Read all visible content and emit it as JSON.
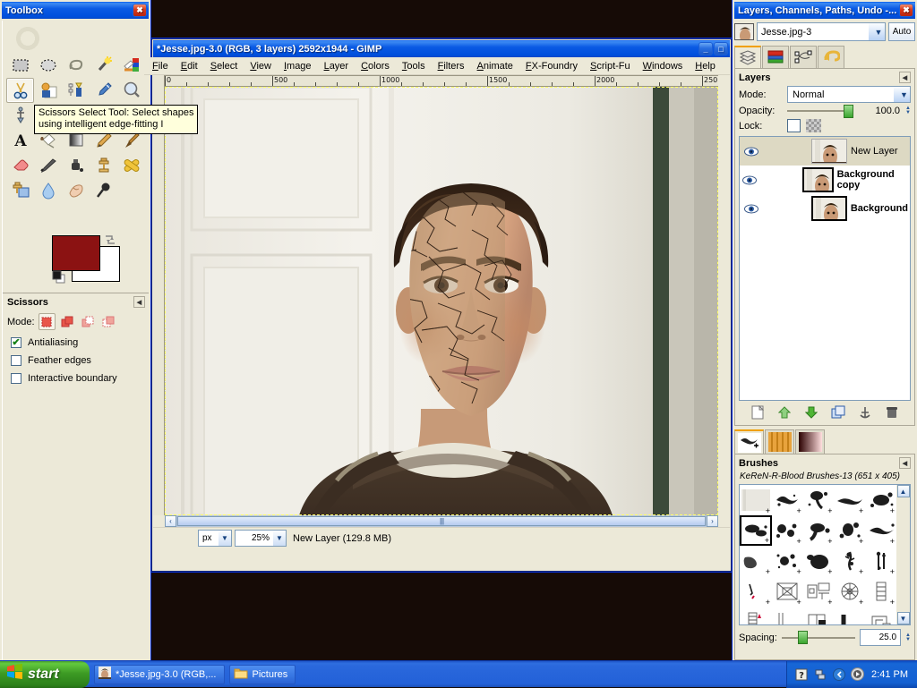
{
  "desktop": {
    "bg_color": "#160b06"
  },
  "toolbox": {
    "title": "Toolbox",
    "close_label": "✖",
    "tools": [
      {
        "name": "rect-select-tool",
        "label": "Rectangle Select"
      },
      {
        "name": "ellipse-select-tool",
        "label": "Ellipse Select"
      },
      {
        "name": "free-select-tool",
        "label": "Free Select"
      },
      {
        "name": "fuzzy-select-tool",
        "label": "Fuzzy Select"
      },
      {
        "name": "select-by-color-tool",
        "label": "Select By Color"
      },
      {
        "name": "scissors-select-tool",
        "label": "Scissors Select"
      },
      {
        "name": "foreground-select-tool",
        "label": "Foreground Select"
      },
      {
        "name": "paths-tool",
        "label": "Paths"
      },
      {
        "name": "color-picker-tool",
        "label": "Color Picker"
      },
      {
        "name": "zoom-tool",
        "label": "Zoom"
      },
      {
        "name": "measure-tool",
        "label": "Measure"
      },
      {
        "name": "move-tool",
        "label": "Move"
      },
      {
        "name": "align-tool",
        "label": "Alignment"
      },
      {
        "name": "crop-tool",
        "label": "Crop"
      },
      {
        "name": "rotate-tool",
        "label": "Rotate"
      },
      {
        "name": "scale-tool",
        "label": "Scale"
      },
      {
        "name": "shear-tool",
        "label": "Shear"
      },
      {
        "name": "perspective-tool",
        "label": "Perspective"
      },
      {
        "name": "flip-tool",
        "label": "Flip"
      },
      {
        "name": "text-tool",
        "label": "Text"
      },
      {
        "name": "bucket-fill-tool",
        "label": "Bucket Fill"
      },
      {
        "name": "blend-tool",
        "label": "Blend"
      },
      {
        "name": "pencil-tool",
        "label": "Pencil"
      },
      {
        "name": "paintbrush-tool",
        "label": "Paintbrush"
      },
      {
        "name": "eraser-tool",
        "label": "Eraser"
      },
      {
        "name": "airbrush-tool",
        "label": "Airbrush"
      },
      {
        "name": "ink-tool",
        "label": "Ink"
      },
      {
        "name": "clone-tool",
        "label": "Clone"
      },
      {
        "name": "heal-tool",
        "label": "Heal"
      },
      {
        "name": "perspective-clone-tool",
        "label": "Perspective Clone"
      },
      {
        "name": "blur-sharpen-tool",
        "label": "Blur / Sharpen"
      },
      {
        "name": "smudge-tool",
        "label": "Smudge"
      },
      {
        "name": "dodge-burn-tool",
        "label": "Dodge / Burn"
      }
    ],
    "selected_tool_index": 5,
    "colors": {
      "foreground": "#8b1212",
      "background": "#ffffff"
    },
    "tooltip": "Scissors Select Tool: Select shapes\nusing intelligent edge-fitting  I",
    "options": {
      "title": "Scissors",
      "mode_label": "Mode:",
      "modes": [
        "replace",
        "add",
        "subtract",
        "intersect"
      ],
      "selected_mode_index": 0,
      "checkboxes": [
        {
          "label": "Antialiasing",
          "checked": true
        },
        {
          "label": "Feather edges",
          "checked": false
        },
        {
          "label": "Interactive boundary",
          "checked": false
        }
      ],
      "check_glyph": "✔"
    }
  },
  "image_window": {
    "title": "*Jesse.jpg-3.0 (RGB, 3 layers) 2592x1944 - GIMP",
    "minimize_label": "_",
    "maximize_label": "□",
    "menus": [
      "File",
      "Edit",
      "Select",
      "View",
      "Image",
      "Layer",
      "Colors",
      "Tools",
      "Filters",
      "Animate",
      "FX-Foundry",
      "Script-Fu",
      "Windows",
      "Help"
    ],
    "ruler": {
      "labels": [
        "0",
        "500",
        "1000",
        "1500",
        "2000",
        "250"
      ],
      "unit": "px"
    },
    "statusbar": {
      "unit": "px",
      "zoom": "25%",
      "message": "New Layer (129.8 MB)"
    },
    "scroll": {
      "left_arrow": "‹",
      "right_arrow": "›",
      "grip": "||||"
    }
  },
  "dock": {
    "title": "Layers, Channels, Paths, Undo -...",
    "close_label": "✖",
    "image_name": "Jesse.jpg-3",
    "auto_label": "Auto",
    "tabs": [
      {
        "name": "tab-layers",
        "label": "Layers"
      },
      {
        "name": "tab-channels",
        "label": "Channels"
      },
      {
        "name": "tab-paths",
        "label": "Paths"
      },
      {
        "name": "tab-undo-history",
        "label": "Undo History"
      }
    ],
    "selected_tab_index": 0,
    "layers_panel": {
      "title": "Layers",
      "mode_label": "Mode:",
      "mode_value": "Normal",
      "opacity_label": "Opacity:",
      "opacity_value": "100.0",
      "lock_label": "Lock:",
      "layers": [
        {
          "name": "New Layer",
          "visible": true,
          "selected": true,
          "bold": false
        },
        {
          "name": "Background copy",
          "visible": true,
          "selected": false,
          "bold": true
        },
        {
          "name": "Background",
          "visible": true,
          "selected": false,
          "bold": true
        }
      ],
      "buttons": [
        {
          "name": "new-layer-button",
          "label": "New Layer"
        },
        {
          "name": "raise-layer-button",
          "label": "Raise Layer"
        },
        {
          "name": "lower-layer-button",
          "label": "Lower Layer"
        },
        {
          "name": "duplicate-layer-button",
          "label": "Duplicate Layer"
        },
        {
          "name": "anchor-layer-button",
          "label": "Anchor Layer"
        },
        {
          "name": "delete-layer-button",
          "label": "Delete Layer"
        }
      ]
    },
    "brushes_panel": {
      "tabs": [
        {
          "name": "tab-brushes",
          "label": "Brushes"
        },
        {
          "name": "tab-patterns",
          "label": "Patterns"
        },
        {
          "name": "tab-gradients",
          "label": "Gradients"
        }
      ],
      "selected_tab_index": 0,
      "title": "Brushes",
      "current_brush": "KeReN-R-Blood Brushes-13 (651 x 405)",
      "spacing_label": "Spacing:",
      "spacing_value": "25.0",
      "selected_brush_index": 5
    }
  },
  "taskbar": {
    "start_label": "start",
    "items": [
      {
        "name": "taskbar-item-gimp",
        "label": "*Jesse.jpg-3.0 (RGB,..."
      },
      {
        "name": "taskbar-item-pictures",
        "label": "Pictures"
      }
    ],
    "clock": "2:41 PM",
    "tray_icons": [
      "help-icon",
      "network-icon",
      "show-hidden-icon",
      "media-icon"
    ]
  }
}
